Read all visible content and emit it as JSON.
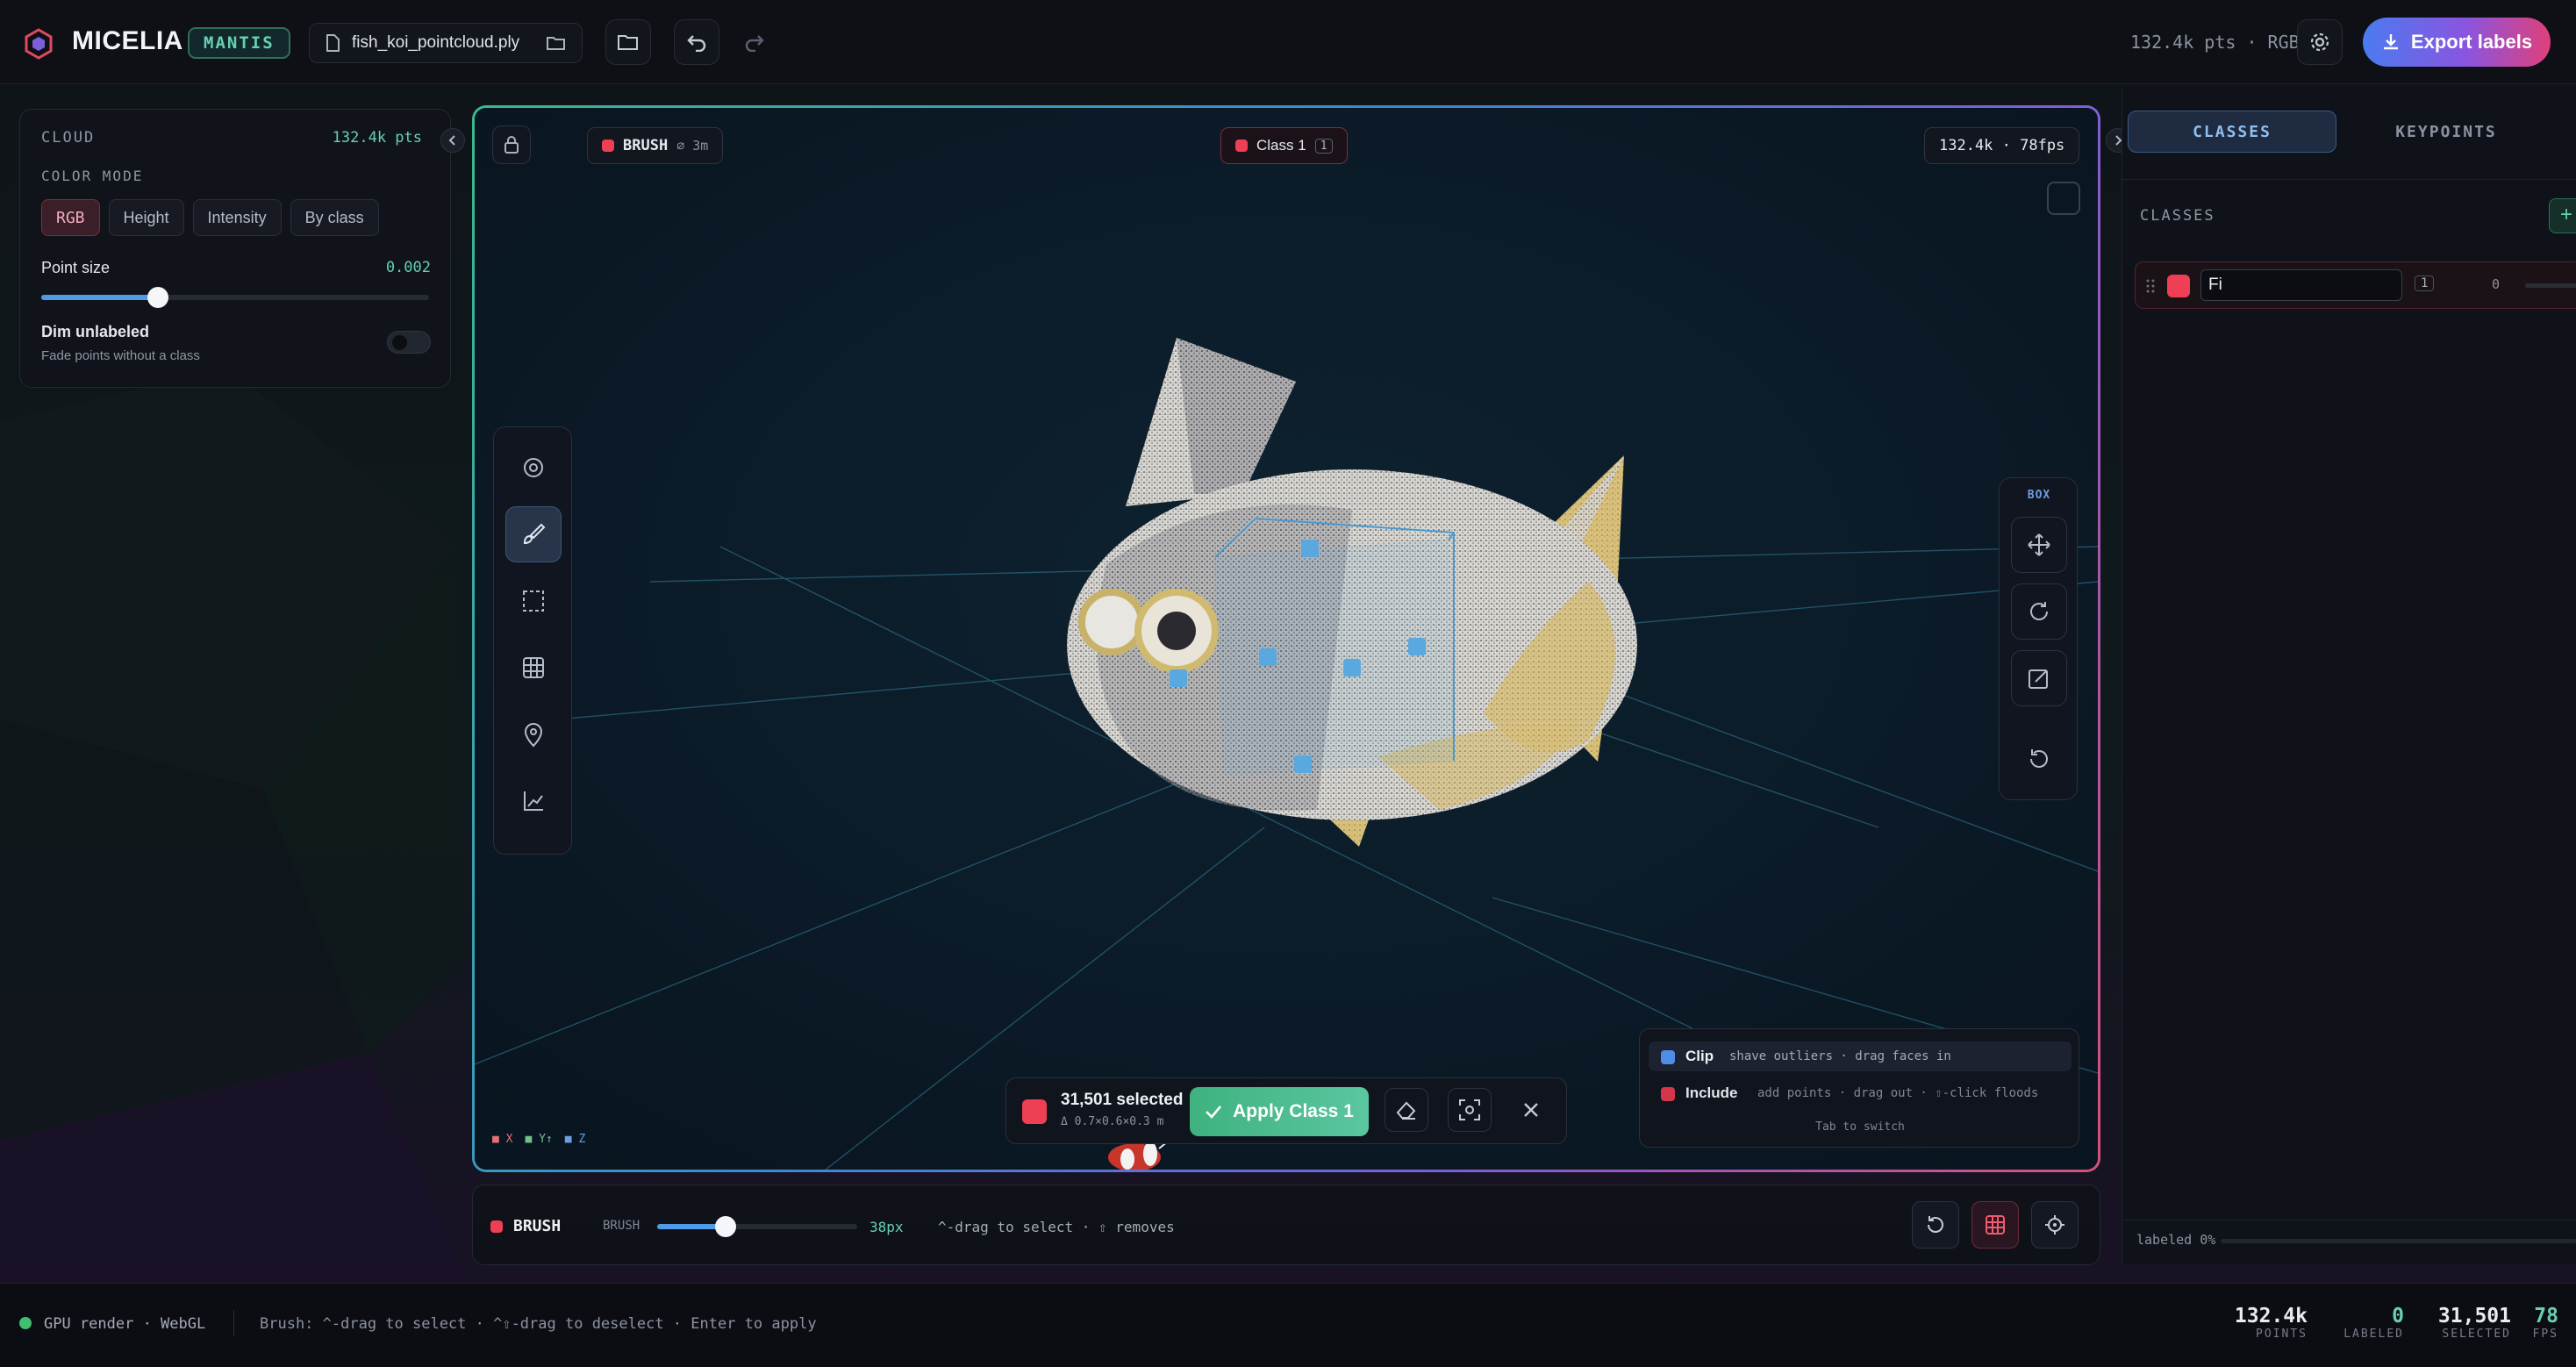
{
  "app": {
    "name": "MICELIA",
    "badge": "MANTIS",
    "file_name": "fish_koi_pointcloud.ply",
    "point_summary": "132.4k pts · RGB",
    "export_label": "Export labels"
  },
  "colors": {
    "accent_red": "#ef3f54",
    "accent_teal": "#4fc0a0",
    "export_gradient": "#4a7bf0 → #e0407a",
    "label_yellow": "#d8c07a"
  },
  "cloud_panel": {
    "title": "CLOUD",
    "point_count": "132.4k pts",
    "color_mode_label": "COLOR MODE",
    "color_modes": [
      "RGB",
      "Height",
      "Intensity",
      "By class"
    ],
    "active_mode": "RGB",
    "point_size_label": "Point size",
    "point_size_value": "0.002",
    "point_size_fraction": 0.3,
    "dim_label": "Dim unlabeled",
    "dim_desc": "Fade points without a class",
    "dim_enabled": false
  },
  "viewport": {
    "tool_chip_label": "BRUSH",
    "tool_chip_size": "⌀ 3m",
    "class_chip_label": "Class 1",
    "class_chip_num": "1",
    "stats": "132.4k · 78fps",
    "axes": {
      "x": "X",
      "y": "Y↑",
      "z": "Z"
    }
  },
  "box_panel": {
    "title": "BOX"
  },
  "toolbar_icons": [
    "orbit-icon",
    "brush-icon",
    "box-select-icon",
    "grid-icon",
    "pin-icon",
    "axes-chart-icon"
  ],
  "box_icons": [
    "move-icon",
    "rotate-icon",
    "edit-box-icon",
    "reset-icon"
  ],
  "selection": {
    "count": "31,501 selected",
    "dims": "Δ 0.7×0.6×0.3 m",
    "apply_label": "Apply Class 1"
  },
  "hints": {
    "clip_label": "Clip",
    "clip_desc": "shave outliers · drag faces in",
    "include_label": "Include",
    "include_desc": "add points · drag out · ⇧-click floods",
    "switch_hint": "Tab to switch"
  },
  "bottom_bar": {
    "mode_label": "BRUSH",
    "slider_label": "BRUSH",
    "slider_value": "38px",
    "slider_fraction": 0.34,
    "hint": "^-drag to select · ⇧ removes"
  },
  "right_panel": {
    "tabs": [
      "CLASSES",
      "KEYPOINTS"
    ],
    "active_tab": "CLASSES",
    "section_title": "CLASSES",
    "class_row": {
      "name_value": "Fi",
      "shortcut": "1",
      "count": "0"
    },
    "footer": "labeled 0%"
  },
  "status_bar": {
    "render": "GPU render · WebGL",
    "hint": "Brush: ^-drag to select · ^⇧-drag to deselect · Enter to apply",
    "stats": [
      {
        "value": "132.4k",
        "label": "POINTS"
      },
      {
        "value": "0",
        "label": "LABELED"
      },
      {
        "value": "31,501",
        "label": "SELECTED"
      },
      {
        "value": "78",
        "label": "FPS"
      }
    ]
  }
}
